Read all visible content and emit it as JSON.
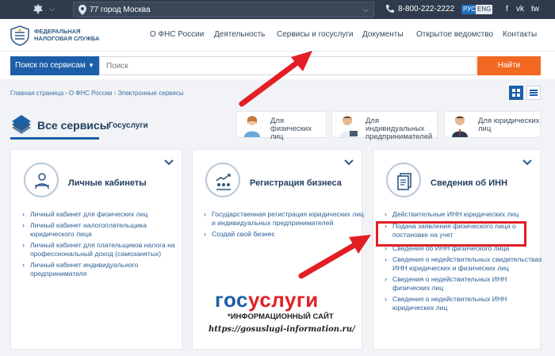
{
  "topbar": {
    "region": "77 город Москва",
    "phone": "8-800-222-2222",
    "lang_ru": "РУС",
    "lang_en": "ENG",
    "social": [
      "f",
      "vk",
      "tw"
    ]
  },
  "header": {
    "logo_line1": "Федеральная",
    "logo_line2": "налоговая служба",
    "nav": [
      "О ФНС России",
      "Деятельность",
      "Сервисы и госуслуги",
      "Документы",
      "Открытое ведомство",
      "Контакты"
    ]
  },
  "search": {
    "select_label": "Поиск по сервисам",
    "placeholder": "Поиск",
    "button": "Найти"
  },
  "breadcrumbs": [
    "Главная страница",
    "О ФНС России",
    "Электронные сервисы"
  ],
  "tabs": {
    "all": "Все сервисы",
    "gos": "Госуслуги",
    "categories": [
      {
        "line1": "Для физических",
        "line2": "лиц"
      },
      {
        "line1": "Для индивидуальных",
        "line2": "предпринимателей"
      },
      {
        "line1": "Для юридических",
        "line2": "лиц"
      }
    ]
  },
  "cards": [
    {
      "title": "Личные кабинеты",
      "items": [
        "Личный кабинет для физических лиц",
        "Личный кабинет налогоплательщика юридического лица",
        "Личный кабинет для плательщиков налога на профессиональный доход (самозанятых)",
        "Личный кабинет индивидуального предпринимателя"
      ]
    },
    {
      "title": "Регистрация бизнеса",
      "items": [
        "Государственная регистрация юридических лиц и индивидуальных предпринимателей",
        "Создай свой бизнес"
      ]
    },
    {
      "title": "Сведения об ИНН",
      "items": [
        "Действительные ИНН юридических лиц",
        "Подача заявления физического лица о постановке на учет",
        "Сведения об ИНН физического лица",
        "Сведения о недействительных свидетельствах ИНН юридических и физических лиц",
        "Сведения о недействительных ИНН физических лиц",
        "Сведения о недействительных ИНН юридических лиц"
      ]
    }
  ],
  "watermark": {
    "logo_part1": "гос",
    "logo_part2": "услуги",
    "subtitle": "*ИНФОРМАЦИОННЫЙ САЙТ",
    "url": "https://gosuslugi-information.ru/"
  },
  "colors": {
    "topbar": "#2f3b4c",
    "accent_blue": "#1d5ea8",
    "find_orange": "#f26722",
    "highlight_red": "#e31e24"
  }
}
